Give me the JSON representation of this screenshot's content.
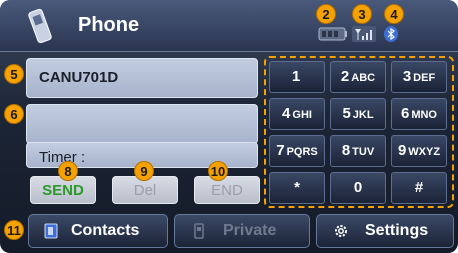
{
  "header": {
    "title": "Phone",
    "icons": [
      "phone-handset-icon",
      "battery-icon",
      "signal-icon",
      "bluetooth-icon"
    ]
  },
  "fields": {
    "number": "CANU701D",
    "name": "",
    "timer": "Timer :"
  },
  "actions": {
    "send": "SEND",
    "del": "Del",
    "end": "END"
  },
  "keypad": {
    "keys": [
      {
        "main": "1",
        "sub": ""
      },
      {
        "main": "2",
        "sub": "ABC"
      },
      {
        "main": "3",
        "sub": "DEF"
      },
      {
        "main": "4",
        "sub": "GHI"
      },
      {
        "main": "5",
        "sub": "JKL"
      },
      {
        "main": "6",
        "sub": "MNO"
      },
      {
        "main": "7",
        "sub": "PQRS"
      },
      {
        "main": "8",
        "sub": "TUV"
      },
      {
        "main": "9",
        "sub": "WXYZ"
      },
      {
        "main": "*",
        "sub": ""
      },
      {
        "main": "0",
        "sub": ""
      },
      {
        "main": "#",
        "sub": ""
      }
    ]
  },
  "bottom": {
    "contacts": "Contacts",
    "private": "Private",
    "settings": "Settings"
  },
  "callouts": [
    "2",
    "3",
    "4",
    "5",
    "6",
    "8",
    "9",
    "10",
    "11"
  ],
  "colors": {
    "accent": "#f5a100",
    "send": "#2a9a2a",
    "field": "#b4c0d6"
  }
}
